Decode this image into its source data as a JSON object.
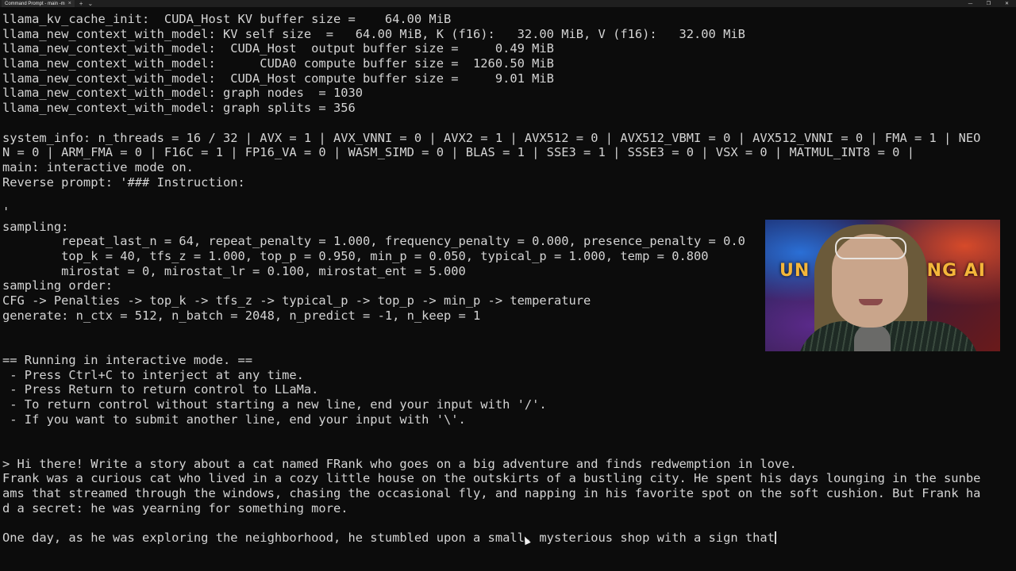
{
  "window": {
    "tab_title": "Command Prompt - main -m",
    "new_tab": "+",
    "tab_dropdown": "⌄",
    "tab_close": "×",
    "controls": [
      "—",
      "❐",
      "✕"
    ]
  },
  "terminal_lines": [
    "llama_kv_cache_init:  CUDA_Host KV buffer size =    64.00 MiB",
    "llama_new_context_with_model: KV self size  =   64.00 MiB, K (f16):   32.00 MiB, V (f16):   32.00 MiB",
    "llama_new_context_with_model:  CUDA_Host  output buffer size =     0.49 MiB",
    "llama_new_context_with_model:      CUDA0 compute buffer size =  1260.50 MiB",
    "llama_new_context_with_model:  CUDA_Host compute buffer size =     9.01 MiB",
    "llama_new_context_with_model: graph nodes  = 1030",
    "llama_new_context_with_model: graph splits = 356",
    "",
    "system_info: n_threads = 16 / 32 | AVX = 1 | AVX_VNNI = 0 | AVX2 = 1 | AVX512 = 0 | AVX512_VBMI = 0 | AVX512_VNNI = 0 | FMA = 1 | NEO",
    "N = 0 | ARM_FMA = 0 | F16C = 1 | FP16_VA = 0 | WASM_SIMD = 0 | BLAS = 1 | SSE3 = 1 | SSSE3 = 0 | VSX = 0 | MATMUL_INT8 = 0 |",
    "main: interactive mode on.",
    "Reverse prompt: '### Instruction:",
    "",
    "'",
    "sampling:",
    "        repeat_last_n = 64, repeat_penalty = 1.000, frequency_penalty = 0.000, presence_penalty = 0.0",
    "        top_k = 40, tfs_z = 1.000, top_p = 0.950, min_p = 0.050, typical_p = 1.000, temp = 0.800",
    "        mirostat = 0, mirostat_lr = 0.100, mirostat_ent = 5.000",
    "sampling order:",
    "CFG -> Penalties -> top_k -> tfs_z -> typical_p -> top_p -> min_p -> temperature",
    "generate: n_ctx = 512, n_batch = 2048, n_predict = -1, n_keep = 1",
    "",
    "",
    "== Running in interactive mode. ==",
    " - Press Ctrl+C to interject at any time.",
    " - Press Return to return control to LLaMa.",
    " - To return control without starting a new line, end your input with '/'.",
    " - If you want to submit another line, end your input with '\\'.",
    "",
    "",
    "> Hi there! Write a story about a cat named FRank who goes on a big adventure and finds redwemption in love.",
    "Frank was a curious cat who lived in a cozy little house on the outskirts of a bustling city. He spent his days lounging in the sunbe",
    "ams that streamed through the windows, chasing the occasional fly, and napping in his favorite spot on the soft cushion. But Frank ha",
    "d a secret: he was yearning for something more.",
    "",
    "One day, as he was exploring the neighborhood, he stumbled upon a small, mysterious shop with a sign that"
  ],
  "webcam": {
    "overlay_left": "UN",
    "overlay_right": "NG AI"
  }
}
